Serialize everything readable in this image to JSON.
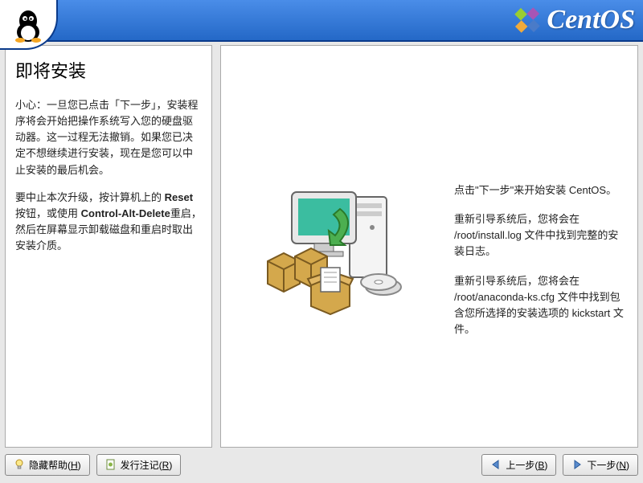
{
  "brand": "CentOS",
  "help": {
    "title": "即将安装",
    "p1": "小心：一旦您已点击「下一步」，安装程序将会开始把操作系统写入您的硬盘驱动器。这一过程无法撤销。如果您已决定不想继续进行安装，现在是您可以中止安装的最后机会。",
    "p2_prefix": "要中止本次升级，按计算机上的 ",
    "p2_reset": "Reset",
    "p2_mid": " 按钮，或使用 ",
    "p2_cad": "Control-Alt-Delete",
    "p2_suffix": "重启，然后在屏幕显示卸载磁盘和重启时取出安装介质。"
  },
  "content": {
    "p1": "点击\"下一步\"来开始安装 CentOS。",
    "p2": "重新引导系统后，您将会在 /root/install.log 文件中找到完整的安装日志。",
    "p3": "重新引导系统后，您将会在 /root/anaconda-ks.cfg 文件中找到包含您所选择的安装选项的 kickstart 文件。"
  },
  "buttons": {
    "hide_help": "隐藏帮助(",
    "hide_help_key": "H",
    "release_notes": "发行注记(",
    "release_notes_key": "R",
    "back": "上一步(",
    "back_key": "B",
    "next": "下一步(",
    "next_key": "N",
    "close_paren": ")"
  }
}
